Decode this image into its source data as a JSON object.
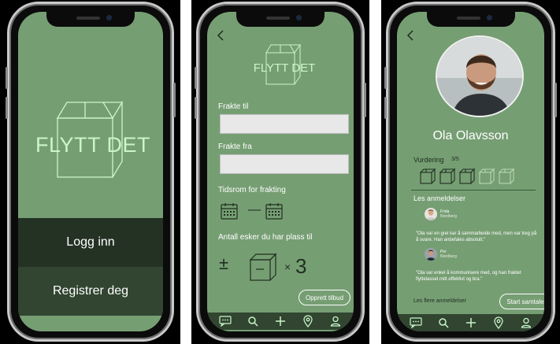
{
  "screen1": {
    "logo_text": "FLYTT DET",
    "login_label": "Logg inn",
    "register_label": "Registrer deg"
  },
  "screen2": {
    "logo_text": "FLYTT DET",
    "to_label": "Frakte til",
    "from_label": "Frakte fra",
    "time_label": "Tidsrom for frakting",
    "date_separator": "—",
    "boxes_label": "Antall esker du har plass til",
    "plus_minus": "±",
    "times_symbol": "×",
    "box_count": "3",
    "create_button": "Opprett tilbud"
  },
  "screen3": {
    "name": "Ola Olavsson",
    "rating_label": "Vurdering",
    "rating_text": "3/5",
    "rating_value": 3,
    "rating_max": 5,
    "reviews_title": "Les anmeldelser",
    "reviews": [
      {
        "user": "Frida",
        "sub": "Nordberg",
        "text": "\"Ola var en grei kar å sammarbeide med, men var treg på å svare. Han anbefales absolutt.\""
      },
      {
        "user": "Per",
        "sub": "Nordberg",
        "text": "\"Ola var enkel å kommunisere med, og han fraktet flyttelasset mitt effektivt og bra.\""
      }
    ],
    "more_reviews": "Les flere anmeldelser",
    "start_chat": "Start samtale"
  },
  "tabbar": {
    "icons": [
      "chat-icon",
      "search-icon",
      "plus-icon",
      "location-icon",
      "user-icon"
    ]
  },
  "colors": {
    "screen_bg": "#769e73",
    "mint": "#c9f7c9",
    "dark_green": "#243224",
    "mid_green": "#314531"
  }
}
